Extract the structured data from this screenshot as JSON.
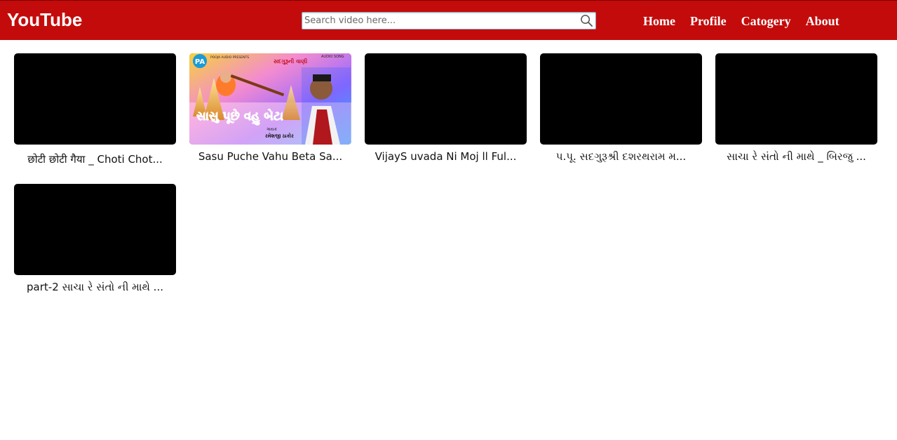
{
  "header": {
    "logo": "YouTube",
    "search_placeholder": "Search video here...",
    "nav": [
      "Home",
      "Profile",
      "Catogery",
      "About"
    ]
  },
  "colors": {
    "header_bg": "#c40b0b",
    "thumb_bg": "#000000"
  },
  "videos": [
    {
      "title": "छोटी छोटी गैया _ Choti Chot...",
      "thumbnail": "black"
    },
    {
      "title": "Sasu Puche Vahu Beta Sa...",
      "thumbnail": "image",
      "thumb_text": {
        "publisher": "POOJA AUDIO PRESENTS",
        "heading": "સદગુરૂની વાણી",
        "tag": "AUDIO SONG",
        "big": "સાસુ પૂછે વહુ બેટા",
        "singer_label": "ગાયક",
        "singer": "રમેશજી ઠાકોર",
        "badge": "PA"
      }
    },
    {
      "title": "VijayS uvada Ni Moj ll Ful...",
      "thumbnail": "black"
    },
    {
      "title": "પ.પૂ. સદગુરૂશ્રી દશરથરામ મ...",
      "thumbnail": "black"
    },
    {
      "title": "સાચા રે સંતો ની માથે _ બિરજુ ...",
      "thumbnail": "black"
    },
    {
      "title": "part-2 સાચા રે સંતો ની માથે ...",
      "thumbnail": "black"
    }
  ]
}
